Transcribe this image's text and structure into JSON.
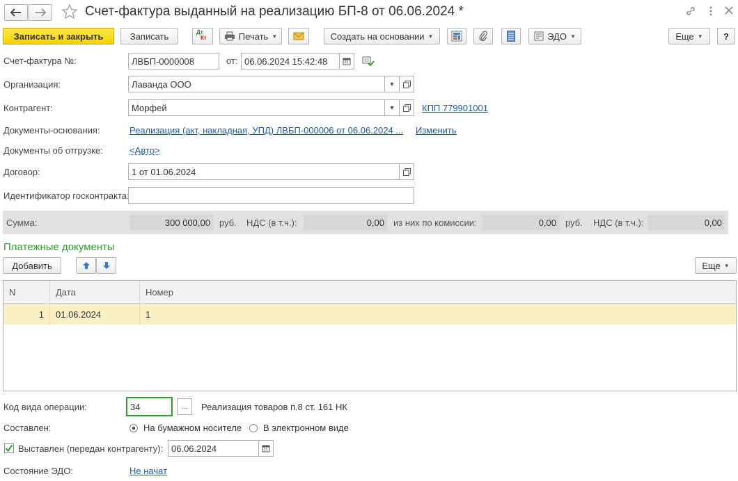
{
  "title": "Счет-фактура выданный на реализацию БП-8 от 06.06.2024 *",
  "toolbar": {
    "save_close": "Записать и закрыть",
    "save": "Записать",
    "dtkt_top": "Дт",
    "dtkt_bottom": "Кт",
    "print": "Печать",
    "create_based": "Создать на основании",
    "edo": "ЭДО",
    "more": "Еще",
    "help": "?"
  },
  "form": {
    "invoice_label": "Счет-фактура №:",
    "invoice_number": "ЛВБП-0000008",
    "from_label": "от:",
    "invoice_date": "06.06.2024 15:42:48",
    "org_label": "Организация:",
    "org_value": "Лаванда ООО",
    "contractor_label": "Контрагент:",
    "contractor_value": "Морфей",
    "kpp_link": "КПП 779901001",
    "base_docs_label": "Документы-основания:",
    "base_docs_link": "Реализация (акт, накладная, УПД) ЛВБП-000006 от 06.06.2024 ...",
    "change_link": "Изменить",
    "shipment_docs_label": "Документы об отгрузке:",
    "shipment_docs_link": "<Авто>",
    "contract_label": "Договор:",
    "contract_value": "1 от 01.06.2024",
    "gov_contract_label": "Идентификатор госконтракта:",
    "gov_contract_value": ""
  },
  "sum": {
    "label": "Сумма:",
    "amount": "300 000,00",
    "currency": "руб.",
    "vat_label": "НДС (в т.ч.):",
    "vat": "0,00",
    "commission_label": "из них по комиссии:",
    "commission": "0,00",
    "currency2": "руб.",
    "vat2_label": "НДС (в т.ч.):",
    "vat2": "0,00"
  },
  "payments": {
    "title": "Платежные документы",
    "add": "Добавить",
    "more": "Еще",
    "columns": [
      "N",
      "Дата",
      "Номер"
    ],
    "rows": [
      {
        "n": "1",
        "date": "01.06.2024",
        "number": "1"
      }
    ]
  },
  "bottom": {
    "op_code_label": "Код вида операции:",
    "op_code": "34",
    "op_code_btn": "...",
    "op_code_desc": "Реализация товаров п.8 ст. 161 НК",
    "composed_label": "Составлен:",
    "paper": "На бумажном носителе",
    "electronic": "В электронном виде",
    "issued_label": "Выставлен (передан контрагенту):",
    "issued_date": "06.06.2024",
    "edo_state_label": "Состояние ЭДО:",
    "edo_state": "Не начат"
  },
  "colors": {
    "accent_green": "#2aa12a",
    "link_blue": "#1c57a8",
    "primary_yellow": "#f5d200",
    "row_highlight": "#fbefc6"
  }
}
